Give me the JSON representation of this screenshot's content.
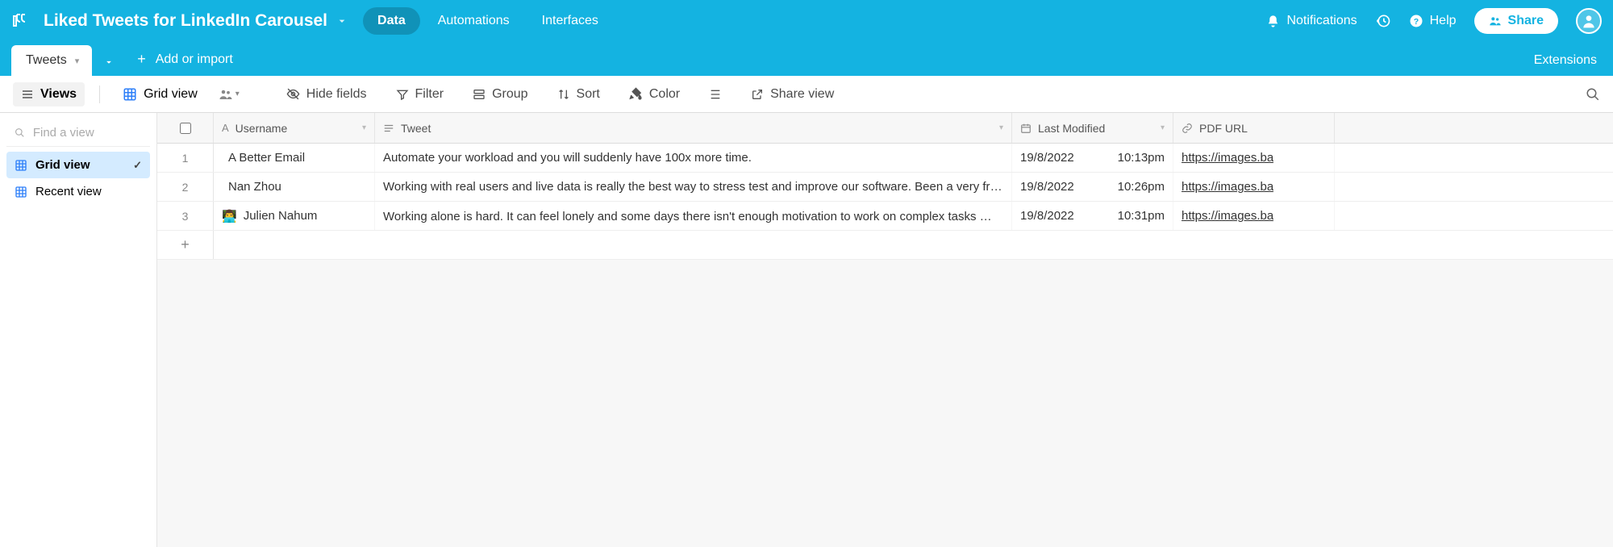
{
  "header": {
    "base_title": "Liked Tweets for LinkedIn Carousel",
    "nav": {
      "data": "Data",
      "automations": "Automations",
      "interfaces": "Interfaces"
    },
    "notifications": "Notifications",
    "help": "Help",
    "share": "Share"
  },
  "tablebar": {
    "table_name": "Tweets",
    "add_import": "Add or import",
    "extensions": "Extensions"
  },
  "toolbar": {
    "views": "Views",
    "gridview": "Grid view",
    "hide_fields": "Hide fields",
    "filter": "Filter",
    "group": "Group",
    "sort": "Sort",
    "color": "Color",
    "share_view": "Share view"
  },
  "sidebar": {
    "find_placeholder": "Find a view",
    "items": [
      {
        "label": "Grid view",
        "selected": true
      },
      {
        "label": "Recent view",
        "selected": false
      }
    ]
  },
  "columns": {
    "username": "Username",
    "tweet": "Tweet",
    "last_modified": "Last Modified",
    "pdf_url": "PDF URL"
  },
  "rows": [
    {
      "n": "1",
      "username": "A Better Email",
      "username_prefix": "",
      "tweet": "Automate your workload and you will suddenly have 100x more time.",
      "date": "19/8/2022",
      "time": "10:13pm",
      "pdf_url": "https://images.ba"
    },
    {
      "n": "2",
      "username": "Nan Zhou",
      "username_prefix": "",
      "tweet": "Working with real users and live data is really the best way to stress test and improve our software. Been a very fruit…",
      "date": "19/8/2022",
      "time": "10:26pm",
      "pdf_url": "https://images.ba"
    },
    {
      "n": "3",
      "username": "Julien Nahum",
      "username_prefix": "👨‍💻",
      "tweet": "Working alone is hard. It can feel lonely and some days there isn't enough motivation to work on complex tasks 😔 …",
      "date": "19/8/2022",
      "time": "10:31pm",
      "pdf_url": "https://images.ba"
    }
  ]
}
